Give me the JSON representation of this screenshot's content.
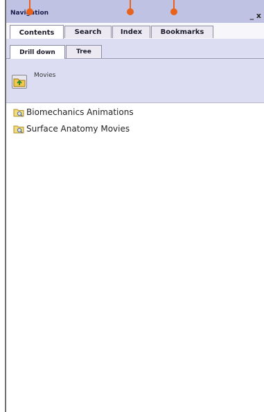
{
  "window": {
    "title": "Navigation",
    "controls": "_ x"
  },
  "tabs": [
    {
      "label": "Contents",
      "active": true
    },
    {
      "label": "Search",
      "active": false
    },
    {
      "label": "Index",
      "active": false
    },
    {
      "label": "Bookmarks",
      "active": false
    }
  ],
  "subtabs": [
    {
      "label": "Drill down",
      "active": true
    },
    {
      "label": "Tree",
      "active": false
    }
  ],
  "breadcrumb": "Movies",
  "tree": [
    {
      "label": "Biomechanics Animations",
      "icon": "folder-search-icon"
    },
    {
      "label": "Surface Anatomy Movies",
      "icon": "folder-search-icon"
    }
  ],
  "colors": {
    "titlebar": "#bfc2e2",
    "subpanel": "#dcdcf2",
    "marker": "#e8621c"
  }
}
